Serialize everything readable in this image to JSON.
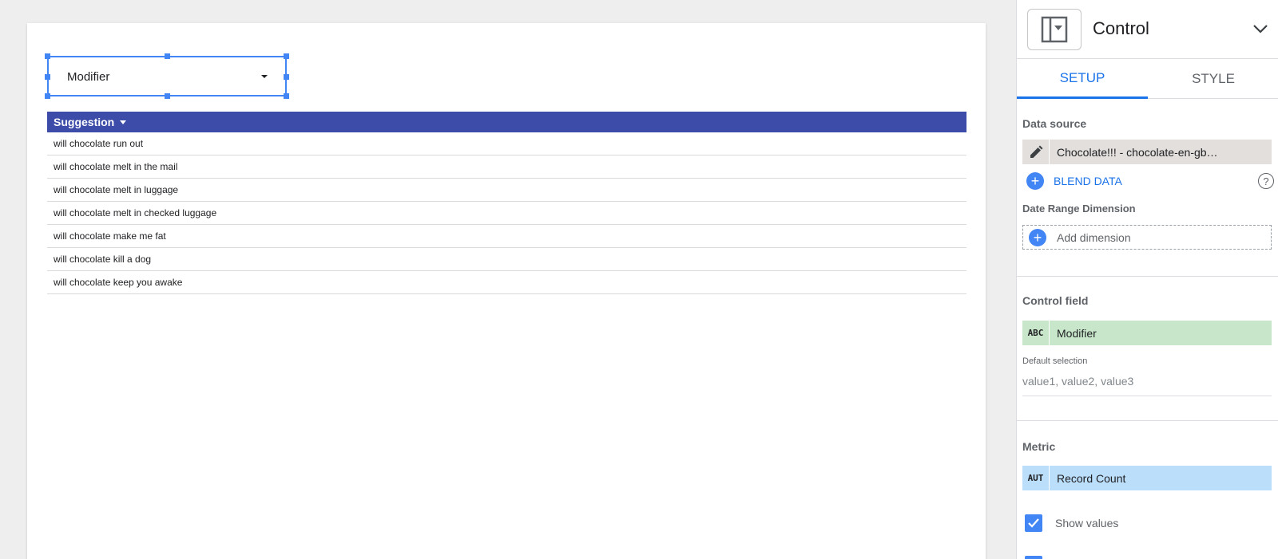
{
  "canvas": {
    "control": {
      "label": "Modifier"
    },
    "table": {
      "header": "Suggestion",
      "rows": [
        "will chocolate run out",
        "will chocolate melt in the mail",
        "will chocolate melt in luggage",
        "will chocolate melt in checked luggage",
        "will chocolate make me fat",
        "will chocolate kill a dog",
        "will chocolate keep you awake"
      ]
    }
  },
  "panel": {
    "title": "Control",
    "tabs": {
      "setup": "SETUP",
      "style": "STYLE"
    },
    "data_source": {
      "section": "Data source",
      "name": "Chocolate!!! - chocolate-en-gb…",
      "blend": "BLEND DATA",
      "help": "?"
    },
    "date_range": {
      "section": "Date Range Dimension",
      "add": "Add dimension"
    },
    "control_field": {
      "section": "Control field",
      "type": "ABC",
      "name": "Modifier",
      "default_label": "Default selection",
      "default_placeholder": "value1, value2, value3"
    },
    "metric": {
      "section": "Metric",
      "type": "AUT",
      "name": "Record Count",
      "show_values": "Show values",
      "show_values_checked": true
    }
  },
  "colors": {
    "accent": "#1a73e8",
    "selection": "#4285f4",
    "table_header": "#3c4ca8",
    "chip_green": "#c8e6c9",
    "chip_blue": "#bbdefb",
    "chip_grey": "#e2dfdc"
  }
}
